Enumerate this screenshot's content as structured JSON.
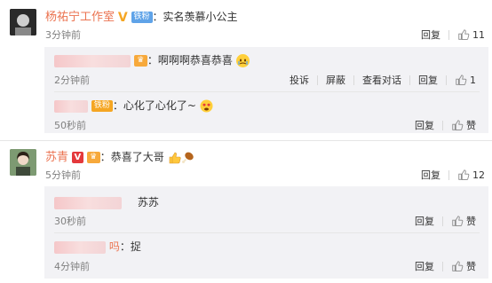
{
  "comments": [
    {
      "user": "杨祐宁工作室",
      "badge": "铁粉",
      "text": "实名羡慕小公主",
      "time": "3分钟前",
      "reply_label": "回复",
      "likes": "11",
      "replies": [
        {
          "text": "啊啊啊恭喜恭喜",
          "time": "2分钟前",
          "actions": [
            "投诉",
            "屏蔽",
            "查看对话",
            "回复"
          ],
          "likes": "1"
        },
        {
          "badge": "铁粉",
          "text": "心化了心化了~",
          "time": "50秒前",
          "reply_label": "回复",
          "like_label": "赞"
        }
      ]
    },
    {
      "user": "苏青",
      "text": "恭喜了大哥",
      "time": "5分钟前",
      "reply_label": "回复",
      "likes": "12",
      "replies": [
        {
          "text": "苏苏",
          "time": "30秒前",
          "reply_label": "回复",
          "like_label": "赞"
        },
        {
          "name_suffix": "吗",
          "text": "捉",
          "time": "4分钟前",
          "reply_label": "回复",
          "like_label": "赞"
        }
      ]
    }
  ],
  "icons": {
    "verified": "V",
    "vip": "vip-icon",
    "thumb": "thumb-up-icon",
    "emoji_cry": "crying-emoji-icon",
    "emoji_heart": "heart-eyes-emoji-icon",
    "emoji_thumb": "thumbs-up-emoji-icon",
    "emoji_drumstick": "drumstick-emoji-icon"
  },
  "colors": {
    "username": "#eb7350",
    "reply_bg": "#f2f2f5",
    "badge": "#5fa3e8"
  }
}
